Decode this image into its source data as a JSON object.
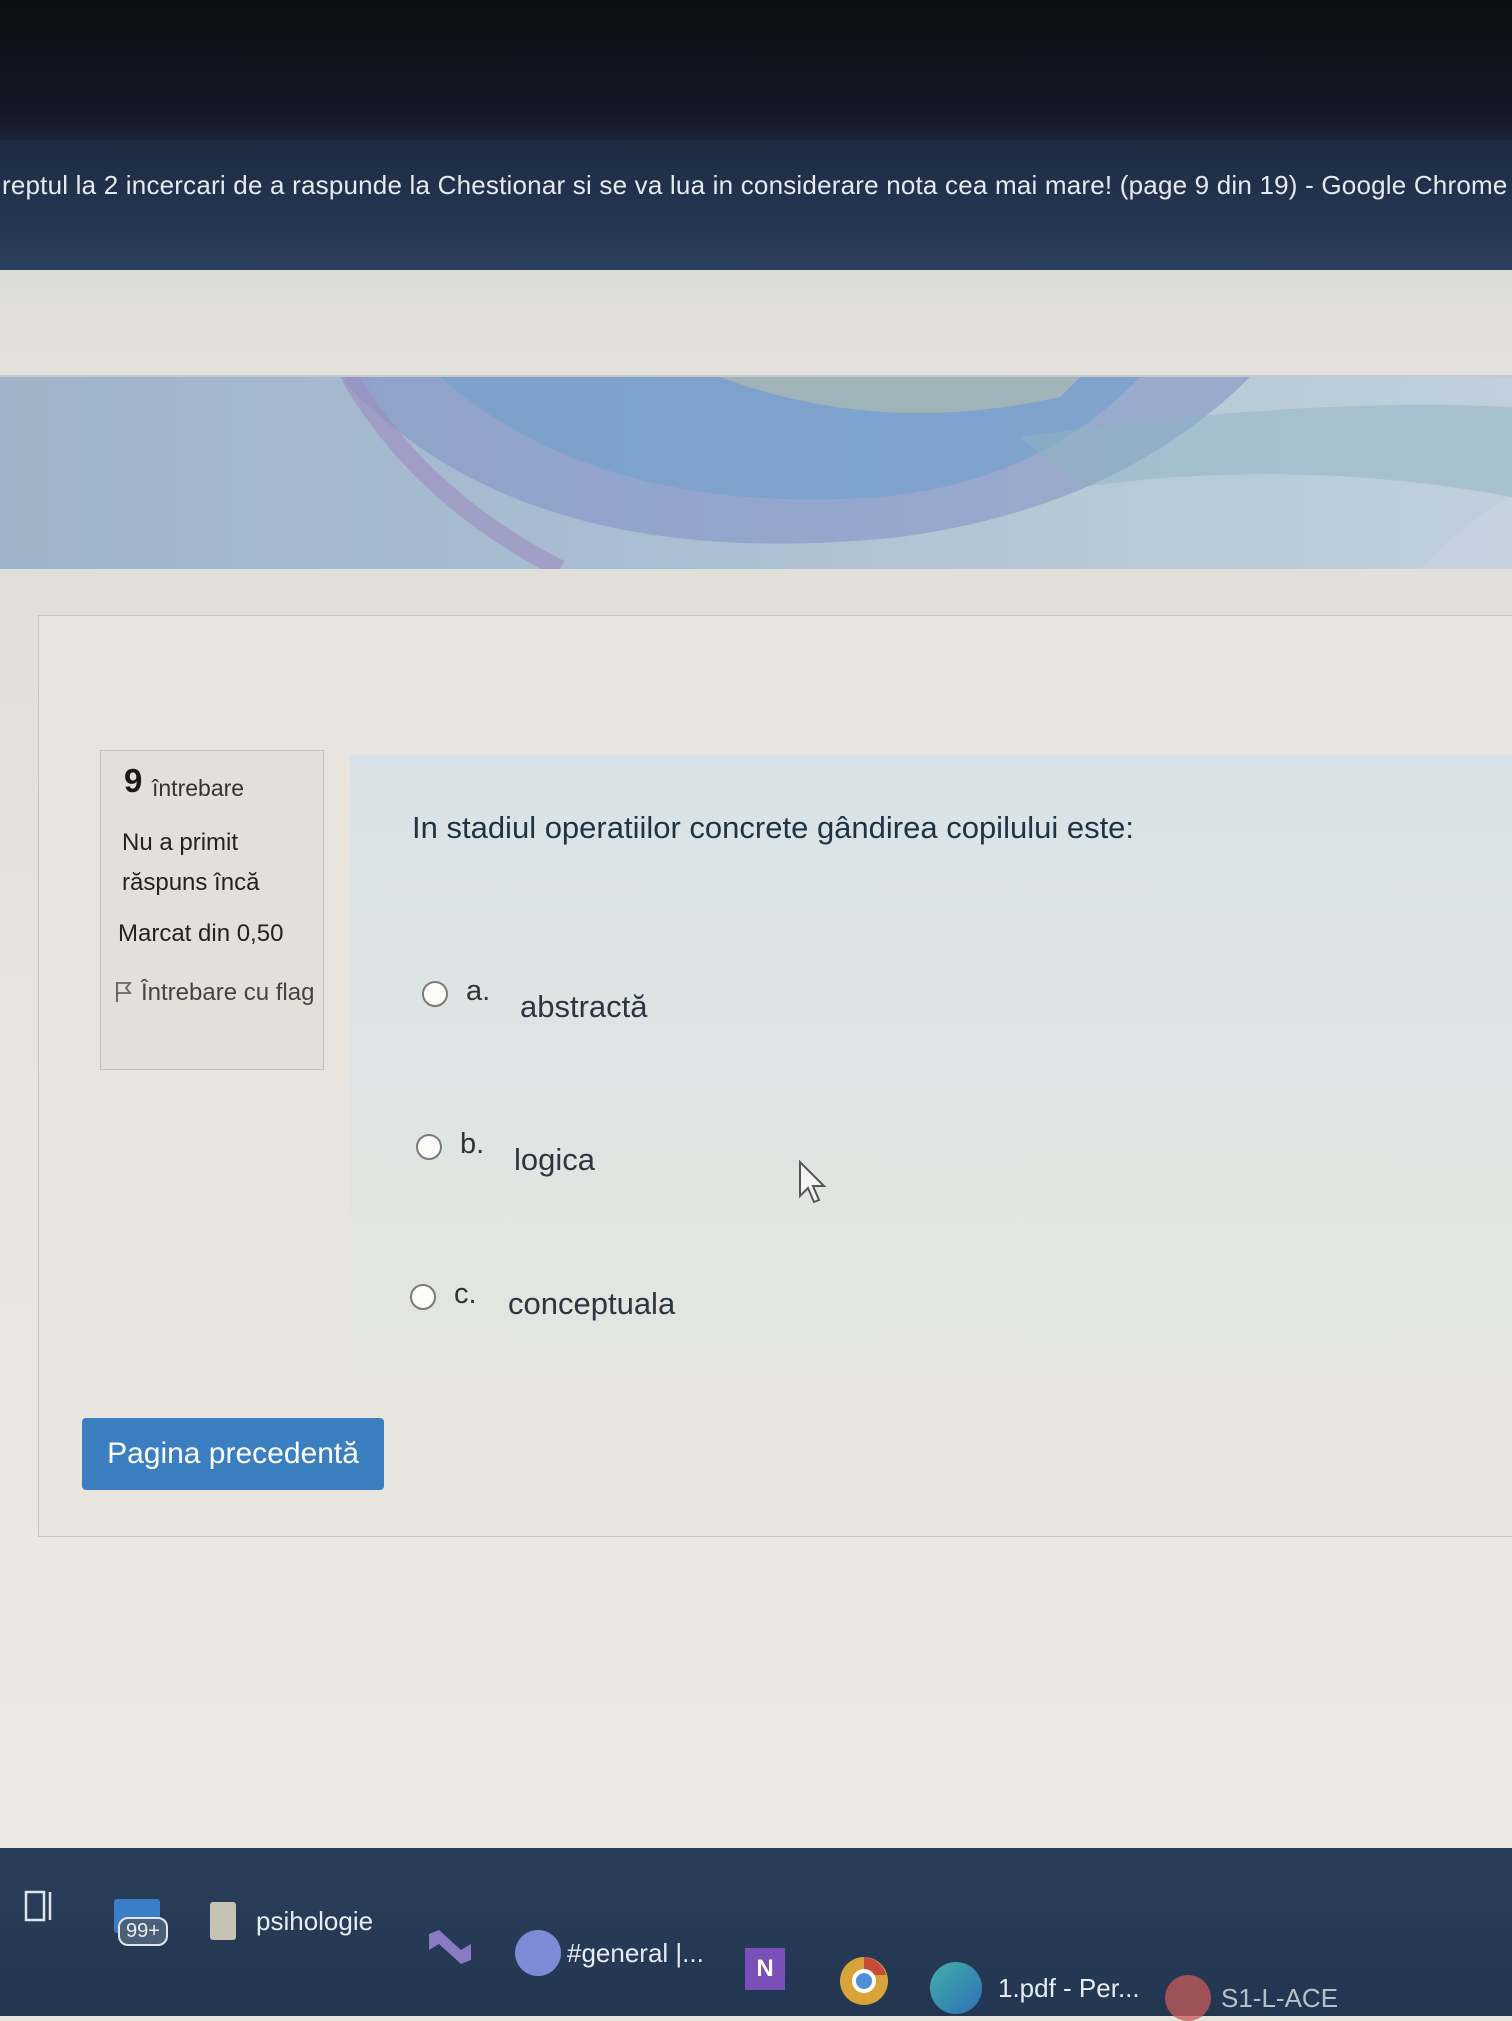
{
  "window": {
    "title": "reptul la 2 incercari de a raspunde la Chestionar si se va lua in considerare nota cea mai mare! (page 9 din 19) - Google Chrome"
  },
  "question_info": {
    "number": "9",
    "label": "întrebare",
    "status": "Nu a primit răspuns încă",
    "marks": "Marcat din 0,50",
    "flag_label": "Întrebare cu flag"
  },
  "question": {
    "text": "In stadiul operatiilor concrete gândirea copilului este:",
    "options": [
      {
        "letter": "a.",
        "text": "abstractă",
        "selected": false
      },
      {
        "letter": "b.",
        "text": "logica",
        "selected": false
      },
      {
        "letter": "c.",
        "text": "conceptuala",
        "selected": false
      }
    ]
  },
  "navigation": {
    "prev_label": "Pagina precedentă"
  },
  "taskbar": {
    "badge": "99+",
    "items": [
      "psihologie",
      "#general |...",
      "1.pdf - Per...",
      "S1-L-ACE"
    ]
  },
  "colors": {
    "accent": "#3b7fc0",
    "title_bar": "#253552",
    "question_panel": "#dfe5e4"
  },
  "icons": [
    "flag-icon",
    "radio-icon",
    "mouse-cursor-icon",
    "task-view-icon",
    "mail-icon",
    "file-explorer-icon",
    "visual-studio-icon",
    "discord-icon",
    "onenote-icon",
    "chrome-icon",
    "edge-icon"
  ]
}
